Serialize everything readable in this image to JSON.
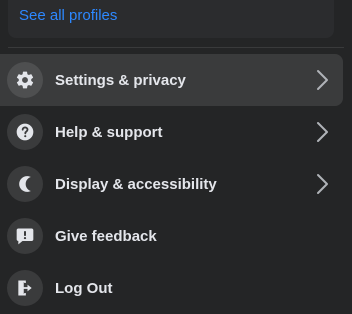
{
  "profile_section": {
    "see_all_label": "See all profiles"
  },
  "colors": {
    "background": "#242526",
    "link": "#2d88ff",
    "text": "#e4e6eb",
    "icon_bg": "#3a3b3c",
    "hover_bg": "#3a3b3c"
  },
  "menu": [
    {
      "label": "Settings & privacy",
      "icon": "gear-icon",
      "has_chevron": true,
      "active": true
    },
    {
      "label": "Help & support",
      "icon": "question-icon",
      "has_chevron": true,
      "active": false
    },
    {
      "label": "Display & accessibility",
      "icon": "moon-icon",
      "has_chevron": true,
      "active": false
    },
    {
      "label": "Give feedback",
      "icon": "feedback-icon",
      "has_chevron": false,
      "active": false
    },
    {
      "label": "Log Out",
      "icon": "logout-icon",
      "has_chevron": false,
      "active": false
    }
  ]
}
